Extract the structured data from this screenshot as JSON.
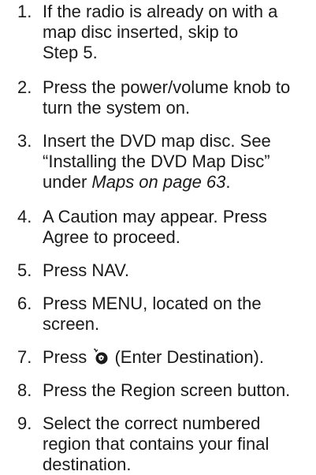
{
  "steps": [
    {
      "number": "1.",
      "lines": [
        "If the radio is already on with a",
        "map disc inserted, skip to",
        "Step 5."
      ]
    },
    {
      "number": "2.",
      "lines": [
        "Press the power/volume knob to",
        "turn the system on."
      ]
    },
    {
      "number": "3.",
      "line1": "Insert the DVD map disc. See",
      "line2": "“Installing the DVD Map Disc”",
      "line3_prefix": "under ",
      "line3_italic": "Maps on page 63",
      "line3_suffix": "."
    },
    {
      "number": "4.",
      "lines": [
        "A Caution may appear. Press",
        "Agree to proceed."
      ]
    },
    {
      "number": "5.",
      "lines": [
        "Press NAV."
      ]
    },
    {
      "number": "6.",
      "lines": [
        "Press MENU, located on the",
        "screen."
      ]
    },
    {
      "number": "7.",
      "prefix": "Press ",
      "icon": "enter-destination-icon",
      "suffix": " (Enter Destination)."
    },
    {
      "number": "8.",
      "lines": [
        "Press the Region screen button."
      ]
    },
    {
      "number": "9.",
      "lines": [
        "Select the correct numbered",
        "region that contains your final",
        "destination."
      ]
    }
  ]
}
